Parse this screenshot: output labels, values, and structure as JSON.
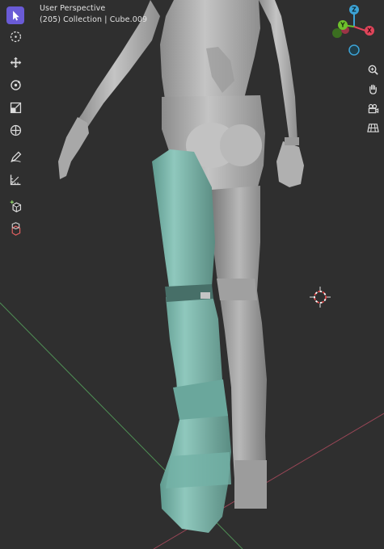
{
  "viewport": {
    "header": {
      "title": "User Perspective",
      "subtitle": "(205) Collection | Cube.009"
    },
    "gizmo": {
      "axes": [
        "Z",
        "Y",
        "X"
      ],
      "colors": {
        "x": "#e0455a",
        "y": "#6ec12c",
        "z": "#3ca3d6",
        "neg_x": "#9b3446",
        "neg_y": "#3b6e20",
        "neg_z": "#2a6f8f"
      }
    },
    "toolbar": {
      "tools": [
        "select-box",
        "cursor",
        "move",
        "rotate",
        "scale",
        "transform",
        "annotate",
        "measure",
        "add-cube",
        "extrude-region"
      ],
      "active": "select-box",
      "accent": "#6a5bd6"
    },
    "navigation": [
      "zoom",
      "pan",
      "camera",
      "grid-view"
    ],
    "scene": {
      "base_color": "#a9a9a9",
      "armor_color": "#7fb8ad",
      "axis_x_color": "#a54a5a",
      "axis_y_color": "#55935a"
    }
  }
}
